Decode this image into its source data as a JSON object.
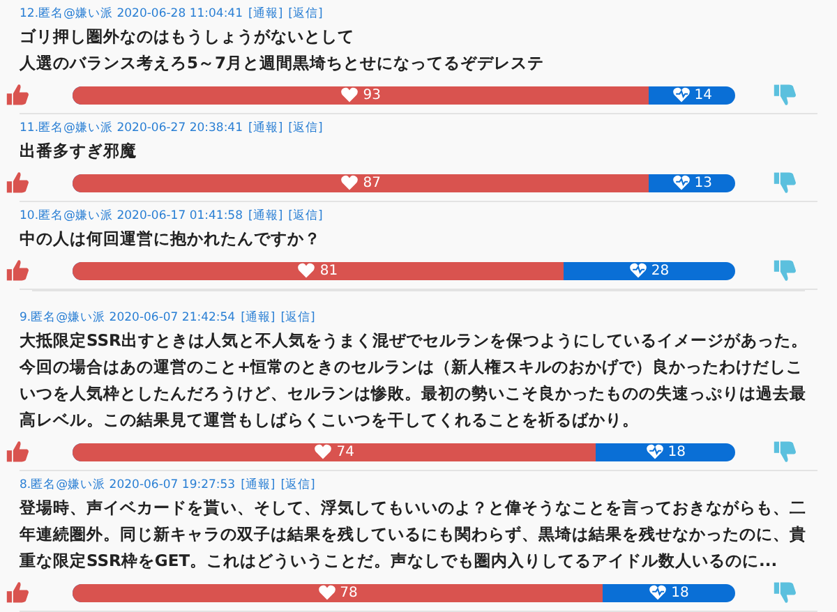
{
  "comments": [
    {
      "meta": "12.匿名@嫌い派 2020-06-28 11:04:41",
      "report": "[通報]",
      "reply": "[返信]",
      "lines": [
        "ゴリ押し圏外なのはもうしょうがないとして",
        "人選のバランス考えろ5～7月と週間黒埼ちとせになってるぞデレステ"
      ],
      "likes": "93",
      "dislikes": "14",
      "level": 0.87
    },
    {
      "meta": "11.匿名@嫌い派 2020-06-27 20:38:41",
      "report": "[通報]",
      "reply": "[返信]",
      "lines": [
        "出番多すぎ邪魔"
      ],
      "likes": "87",
      "dislikes": "13",
      "level": 0.87
    },
    {
      "meta": "10.匿名@嫌い派 2020-06-17 01:41:58",
      "report": "[通報]",
      "reply": "[返信]",
      "lines": [
        "中の人は何回運営に抱かれたんですか？"
      ],
      "likes": "81",
      "dislikes": "28",
      "level": 0.74
    },
    {
      "meta": "9.匿名@嫌い派 2020-06-07 21:42:54",
      "report": "[通報]",
      "reply": "[返信]",
      "lines": [
        "大抵限定SSR出すときは人気と不人気をうまく混ぜでセルランを保つようにしているイメージがあった。今回の場合はあの運営のこと+恒常のときのセルランは（新人権スキルのおかげで）良かったわけだしこいつを人気枠としたんだろうけど、セルランは惨敗。最初の勢いこそ良かったものの失速っぷりは過去最高レベル。この結果見て運営もしばらくこいつを干してくれることを祈るばかり。"
      ],
      "likes": "74",
      "dislikes": "18",
      "level": 0.79
    },
    {
      "meta": "8.匿名@嫌い派 2020-06-07 19:27:53",
      "report": "[通報]",
      "reply": "[返信]",
      "lines": [
        "登場時、声イベカードを貰い、そして、浮気してもいいのよ？と偉そうなことを言っておきながらも、二年連続圏外。同じ新キャラの双子は結果を残しているにも関わらず、黒埼は結果を残せなかったのに、貴重な限定SSR枠をGET。これはどういうことだ。声なしでも圏内入りしてるアイドル数人いるのに..."
      ],
      "likes": "78",
      "dislikes": "18",
      "level": 0.8
    }
  ]
}
